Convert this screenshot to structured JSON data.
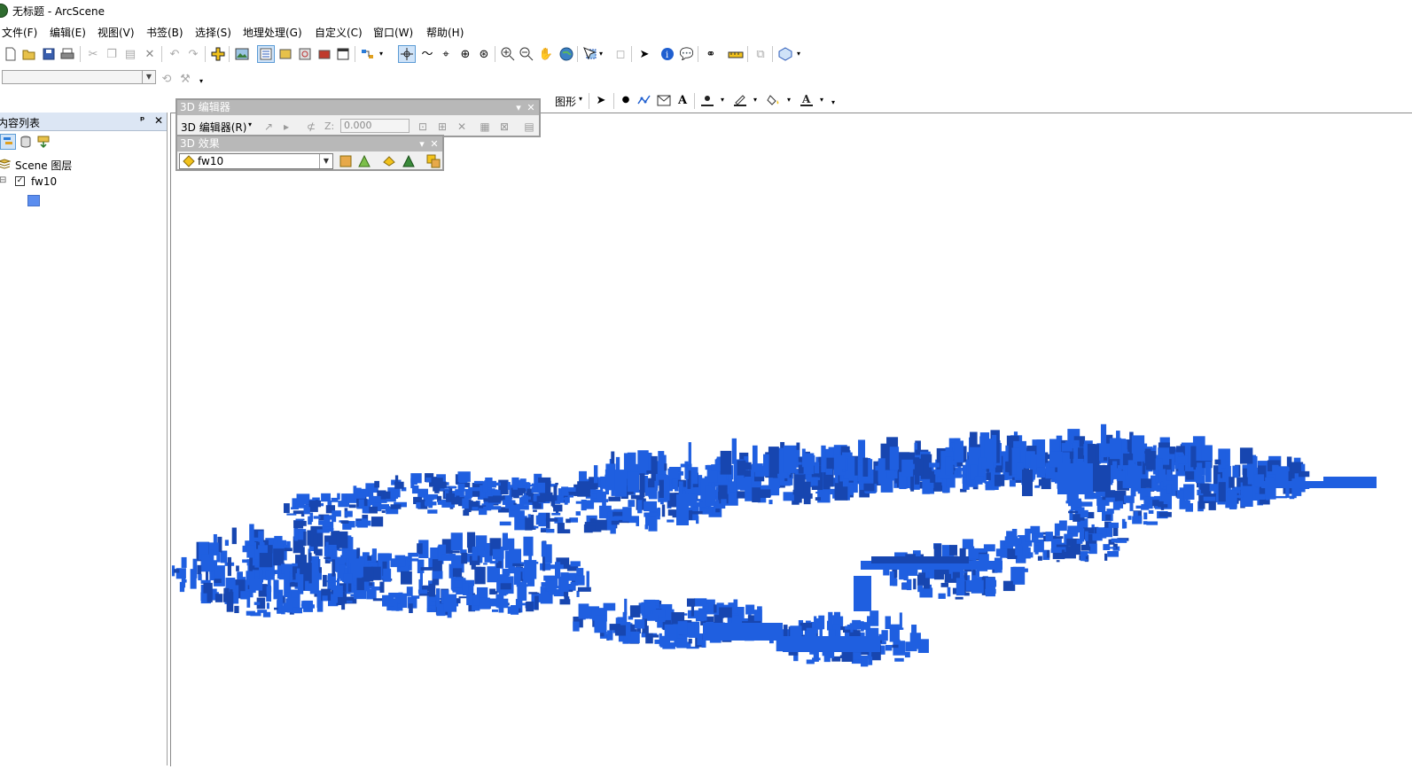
{
  "window": {
    "title": "无标题 - ArcScene"
  },
  "menu": [
    "文件(F)",
    "编辑(E)",
    "视图(V)",
    "书签(B)",
    "选择(S)",
    "地理处理(G)",
    "自定义(C)",
    "窗口(W)",
    "帮助(H)"
  ],
  "graphics_toolbar": {
    "label": "图形",
    "text_tool": "A"
  },
  "toc": {
    "title": "内容列表",
    "pin": "ᵖ",
    "close": "✕",
    "root": "Scene 图层",
    "layer": {
      "name": "fw10",
      "checked": true,
      "expander": "⊟",
      "check_mark": "✓",
      "symbol_color": "#5b8def"
    }
  },
  "editor_panel": {
    "title": "3D 编辑器",
    "menu_label": "3D 编辑器(R)",
    "z_label": "Z:",
    "z_value": "0.000",
    "menu_arrow": "▾",
    "close": "✕"
  },
  "effects_panel": {
    "title": "3D 效果",
    "layer_value": "fw10",
    "menu_arrow": "▾",
    "close": "✕"
  },
  "scene": {
    "building_color": "#1f5fe0",
    "shadow_color": "#1746b0"
  },
  "colors": {
    "toc_header": "#dce6f4",
    "panel_title": "#b8b8b8",
    "selection": "#cfe3f8"
  }
}
